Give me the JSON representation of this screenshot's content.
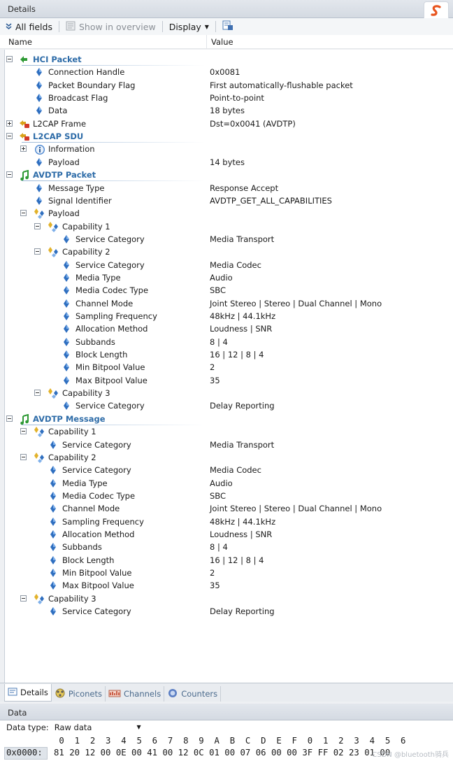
{
  "details_header": {
    "title": "Details"
  },
  "toolbar": {
    "all_fields": "All fields",
    "show_in_overview": "Show in overview",
    "display": "Display"
  },
  "columns": {
    "name": "Name",
    "value": "Value"
  },
  "tree": [
    {
      "label": "HCI Packet",
      "value": "",
      "level": 0,
      "kind": "section",
      "icon": "arrow-left-icon",
      "expander": "minus"
    },
    {
      "label": "Connection Handle",
      "value": "0x0081",
      "level": 1,
      "kind": "field",
      "icon": "field-diamond-icon"
    },
    {
      "label": "Packet Boundary Flag",
      "value": "First automatically-flushable packet",
      "level": 1,
      "kind": "field",
      "icon": "field-diamond-icon"
    },
    {
      "label": "Broadcast Flag",
      "value": "Point-to-point",
      "level": 1,
      "kind": "field",
      "icon": "field-diamond-icon"
    },
    {
      "label": "Data",
      "value": "18 bytes",
      "level": 1,
      "kind": "field",
      "icon": "field-diamond-icon"
    },
    {
      "label": "L2CAP Frame",
      "value": "Dst=0x0041 (AVDTP)",
      "level": 0,
      "kind": "node",
      "icon": "l2cap-icon",
      "expander": "plus"
    },
    {
      "label": "L2CAP SDU",
      "value": "",
      "level": 0,
      "kind": "section",
      "icon": "l2cap-icon",
      "expander": "minus"
    },
    {
      "label": "Information",
      "value": "",
      "level": 1,
      "kind": "node",
      "icon": "info-icon",
      "expander": "plus"
    },
    {
      "label": "Payload",
      "value": "14 bytes",
      "level": 1,
      "kind": "field",
      "icon": "field-diamond-icon"
    },
    {
      "label": "AVDTP Packet",
      "value": "",
      "level": 0,
      "kind": "section",
      "icon": "music-note-icon",
      "expander": "minus"
    },
    {
      "label": "Message Type",
      "value": "Response Accept",
      "level": 1,
      "kind": "field",
      "icon": "field-diamond-icon"
    },
    {
      "label": "Signal Identifier",
      "value": "AVDTP_GET_ALL_CAPABILITIES",
      "level": 1,
      "kind": "field",
      "icon": "field-diamond-icon"
    },
    {
      "label": "Payload",
      "value": "",
      "level": 1,
      "kind": "node",
      "icon": "group-icon",
      "expander": "minus"
    },
    {
      "label": "Capability 1",
      "value": "",
      "level": 2,
      "kind": "node",
      "icon": "group-icon",
      "expander": "minus"
    },
    {
      "label": "Service Category",
      "value": "Media Transport",
      "level": 3,
      "kind": "field",
      "icon": "field-diamond-icon"
    },
    {
      "label": "Capability 2",
      "value": "",
      "level": 2,
      "kind": "node",
      "icon": "group-icon",
      "expander": "minus"
    },
    {
      "label": "Service Category",
      "value": "Media Codec",
      "level": 3,
      "kind": "field",
      "icon": "field-diamond-icon"
    },
    {
      "label": "Media Type",
      "value": "Audio",
      "level": 3,
      "kind": "field",
      "icon": "field-diamond-icon"
    },
    {
      "label": "Media Codec Type",
      "value": "SBC",
      "level": 3,
      "kind": "field",
      "icon": "field-diamond-icon"
    },
    {
      "label": "Channel Mode",
      "value": "Joint Stereo | Stereo | Dual Channel | Mono",
      "level": 3,
      "kind": "field",
      "icon": "field-diamond-icon"
    },
    {
      "label": "Sampling Frequency",
      "value": "48kHz | 44.1kHz",
      "level": 3,
      "kind": "field",
      "icon": "field-diamond-icon"
    },
    {
      "label": "Allocation Method",
      "value": "Loudness | SNR",
      "level": 3,
      "kind": "field",
      "icon": "field-diamond-icon"
    },
    {
      "label": "Subbands",
      "value": "8 | 4",
      "level": 3,
      "kind": "field",
      "icon": "field-diamond-icon"
    },
    {
      "label": "Block Length",
      "value": "16 | 12 | 8 | 4",
      "level": 3,
      "kind": "field",
      "icon": "field-diamond-icon"
    },
    {
      "label": "Min Bitpool Value",
      "value": "2",
      "level": 3,
      "kind": "field",
      "icon": "field-diamond-icon"
    },
    {
      "label": "Max Bitpool Value",
      "value": "35",
      "level": 3,
      "kind": "field",
      "icon": "field-diamond-icon"
    },
    {
      "label": "Capability 3",
      "value": "",
      "level": 2,
      "kind": "node",
      "icon": "group-icon",
      "expander": "minus"
    },
    {
      "label": "Service Category",
      "value": "Delay Reporting",
      "level": 3,
      "kind": "field",
      "icon": "field-diamond-icon"
    },
    {
      "label": "AVDTP Message",
      "value": "",
      "level": 0,
      "kind": "section",
      "icon": "music-note-icon",
      "expander": "minus"
    },
    {
      "label": "Capability 1",
      "value": "",
      "level": 1,
      "kind": "node",
      "icon": "group-icon",
      "expander": "minus"
    },
    {
      "label": "Service Category",
      "value": "Media Transport",
      "level": 2,
      "kind": "field",
      "icon": "field-diamond-icon"
    },
    {
      "label": "Capability 2",
      "value": "",
      "level": 1,
      "kind": "node",
      "icon": "group-icon",
      "expander": "minus"
    },
    {
      "label": "Service Category",
      "value": "Media Codec",
      "level": 2,
      "kind": "field",
      "icon": "field-diamond-icon"
    },
    {
      "label": "Media Type",
      "value": "Audio",
      "level": 2,
      "kind": "field",
      "icon": "field-diamond-icon"
    },
    {
      "label": "Media Codec Type",
      "value": "SBC",
      "level": 2,
      "kind": "field",
      "icon": "field-diamond-icon"
    },
    {
      "label": "Channel Mode",
      "value": "Joint Stereo | Stereo | Dual Channel | Mono",
      "level": 2,
      "kind": "field",
      "icon": "field-diamond-icon"
    },
    {
      "label": "Sampling Frequency",
      "value": "48kHz | 44.1kHz",
      "level": 2,
      "kind": "field",
      "icon": "field-diamond-icon"
    },
    {
      "label": "Allocation Method",
      "value": "Loudness | SNR",
      "level": 2,
      "kind": "field",
      "icon": "field-diamond-icon"
    },
    {
      "label": "Subbands",
      "value": "8 | 4",
      "level": 2,
      "kind": "field",
      "icon": "field-diamond-icon"
    },
    {
      "label": "Block Length",
      "value": "16 | 12 | 8 | 4",
      "level": 2,
      "kind": "field",
      "icon": "field-diamond-icon"
    },
    {
      "label": "Min Bitpool Value",
      "value": "2",
      "level": 2,
      "kind": "field",
      "icon": "field-diamond-icon"
    },
    {
      "label": "Max Bitpool Value",
      "value": "35",
      "level": 2,
      "kind": "field",
      "icon": "field-diamond-icon"
    },
    {
      "label": "Capability 3",
      "value": "",
      "level": 1,
      "kind": "node",
      "icon": "group-icon",
      "expander": "minus"
    },
    {
      "label": "Service Category",
      "value": "Delay Reporting",
      "level": 2,
      "kind": "field",
      "icon": "field-diamond-icon"
    }
  ],
  "tabs": [
    {
      "label": "Details",
      "icon": "details-icon",
      "active": true
    },
    {
      "label": "Piconets",
      "icon": "piconets-icon",
      "active": false
    },
    {
      "label": "Channels",
      "icon": "channels-icon",
      "active": false
    },
    {
      "label": "Counters",
      "icon": "counters-icon",
      "active": false
    }
  ],
  "data_header": {
    "title": "Data"
  },
  "data_type": {
    "label": "Data type:",
    "selected": "Raw data"
  },
  "hex": {
    "offset_header": [
      "0",
      "1",
      "2",
      "3",
      "4",
      "5",
      "6",
      "7",
      "8",
      "9",
      "A",
      "B",
      "C",
      "D",
      "E",
      "F",
      "0",
      "1",
      "2",
      "3",
      "4",
      "5",
      "6"
    ],
    "address": "0x0000:",
    "bytes": [
      "81",
      "20",
      "12",
      "00",
      "0E",
      "00",
      "41",
      "00",
      "12",
      "0C",
      "01",
      "00",
      "07",
      "06",
      "00",
      "00",
      "3F",
      "FF",
      "02",
      "23",
      "01",
      "00"
    ]
  },
  "watermark": "CSDN @bluetooth骑兵",
  "colors": {
    "section_text": "#2e6ca8",
    "field_diamond": "#2f6fc0",
    "arrow": "#2f9a35"
  }
}
